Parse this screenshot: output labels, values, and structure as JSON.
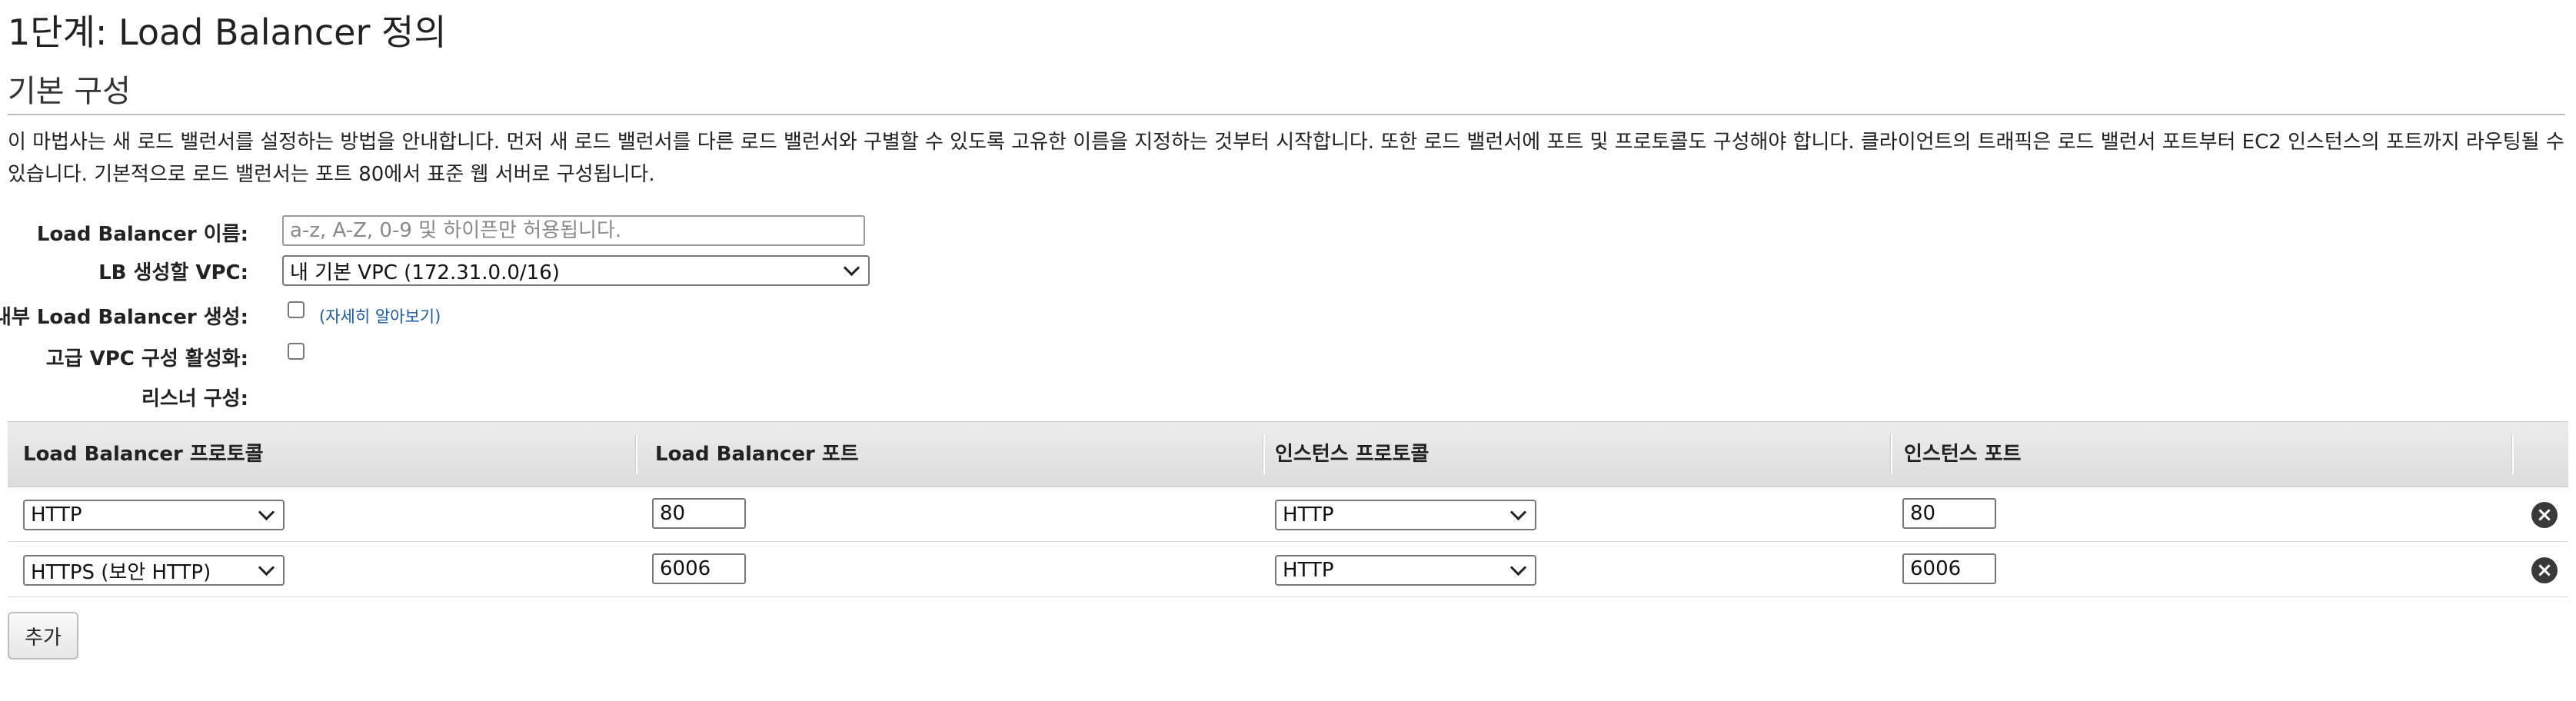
{
  "page": {
    "step_title": "1단계: Load Balancer 정의",
    "section_title": "기본 구성",
    "intro": "이 마법사는 새 로드 밸런서를 설정하는 방법을 안내합니다. 먼저 새 로드 밸런서를 다른 로드 밸런서와 구별할 수 있도록 고유한 이름을 지정하는 것부터 시작합니다. 또한 로드 밸런서에 포트 및 프로토콜도 구성해야 합니다. 클라이언트의 트래픽은 로드 밸런서 포트부터 EC2 인스턴스의 포트까지 라우팅될 수 있습니다. 기본적으로 로드 밸런서는 포트 80에서 표준 웹 서버로 구성됩니다."
  },
  "form": {
    "name_label": "Load Balancer 이름:",
    "name_placeholder": "a-z, A-Z, 0-9 및 하이픈만 허용됩니다.",
    "name_value": "",
    "vpc_label": "LB 생성할 VPC:",
    "vpc_value": "내 기본 VPC (172.31.0.0/16)",
    "internal_label": "내부 Load Balancer 생성:",
    "internal_checked": false,
    "learn_more": "(자세히 알아보기)",
    "advanced_vpc_label": "고급 VPC 구성 활성화:",
    "advanced_vpc_checked": false,
    "listener_label": "리스너 구성:"
  },
  "listeners": {
    "headers": [
      "Load Balancer 프로토콜",
      "Load Balancer 포트",
      "인스턴스 프로토콜",
      "인스턴스 포트"
    ],
    "rows": [
      {
        "lb_protocol": "HTTP",
        "lb_port": "80",
        "instance_protocol": "HTTP",
        "instance_port": "80"
      },
      {
        "lb_protocol": "HTTPS (보안 HTTP)",
        "lb_port": "6006",
        "instance_protocol": "HTTP",
        "instance_port": "6006"
      }
    ],
    "remove_icon": "remove-circle-icon",
    "add_label": "추가"
  },
  "colors": {
    "link": "#1a5aa6",
    "header_bg": "#e4e4e4",
    "remove_icon": "#3a3a3a"
  }
}
